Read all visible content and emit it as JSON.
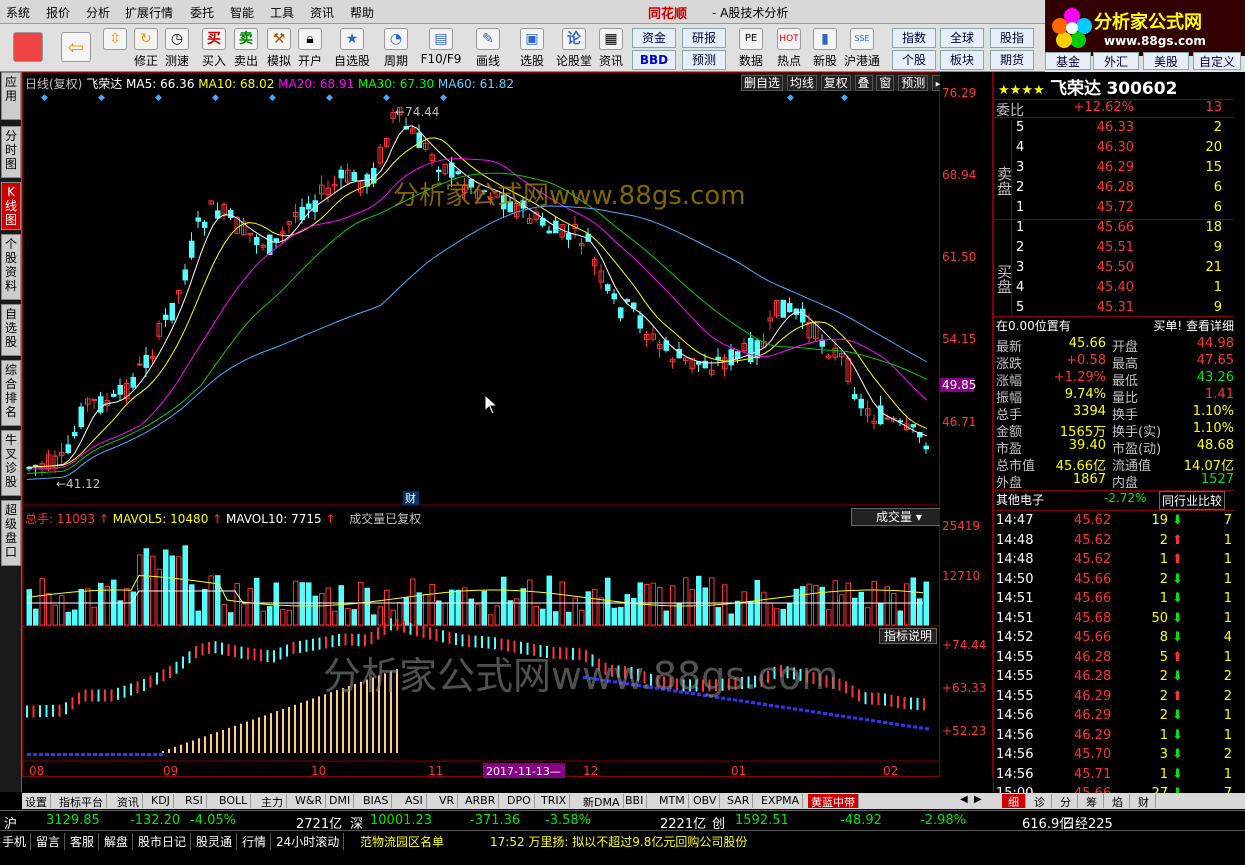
{
  "menu": [
    "系统",
    "报价",
    "分析",
    "扩展行情",
    "委托",
    "智能",
    "工具",
    "资讯",
    "帮助"
  ],
  "app_title": "同花顺",
  "app_sub": "- A股技术分析",
  "logo": {
    "text": "分析家公式网",
    "url": "www.88gs.com"
  },
  "toolbar": [
    "修正",
    "测速",
    "买入",
    "卖出",
    "模拟",
    "开户",
    "自选股",
    "周期",
    "F10/F9",
    "画线",
    "选股",
    "论股堂",
    "资讯",
    "数据",
    "热点",
    "新股",
    "沪港通"
  ],
  "toolbar_small": [
    {
      "label": "资金"
    },
    {
      "label": "研报"
    },
    {
      "label": "指数"
    },
    {
      "label": "全球"
    },
    {
      "label": "股指"
    },
    {
      "label": "BBD"
    },
    {
      "label": "预测"
    },
    {
      "label": "个股"
    },
    {
      "label": "板块"
    },
    {
      "label": "期货"
    },
    {
      "label": "基金"
    },
    {
      "label": "外汇"
    },
    {
      "label": "美股"
    },
    {
      "label": "自定义"
    }
  ],
  "left_nav": [
    {
      "label": "应用"
    },
    {
      "label": "分时图"
    },
    {
      "label": "K线图",
      "active": true
    },
    {
      "label": "个股资料"
    },
    {
      "label": "自选股"
    },
    {
      "label": "综合排名"
    },
    {
      "label": "牛叉诊股"
    },
    {
      "label": "超级盘口"
    }
  ],
  "chart_header": {
    "period": "日线(复权)",
    "name": "飞荣达",
    "ma5": "MA5: 66.36",
    "ma10": "MA10: 68.02",
    "ma20": "MA20: 68.91",
    "ma30": "MA30: 67.30",
    "ma60": "MA60: 61.82",
    "tools": [
      "删自选",
      "均线",
      "复权",
      "叠",
      "窗",
      "预测"
    ]
  },
  "vol_header": {
    "total": "总手: 11093",
    "mavol5": "MAVOL5: 10480",
    "mavol10": "MAVOL10: 7715",
    "note": "成交量已复权",
    "select": "成交量"
  },
  "indicator_btn": "指标说明",
  "price_axis": [
    "76.29",
    "68.94",
    "61.50",
    "54.15",
    "46.71"
  ],
  "price_current": "49.85",
  "high_label": "74.44",
  "low_label": "41.12",
  "cai_label": "财",
  "vol_axis": [
    "25419",
    "12710"
  ],
  "ind_axis": [
    "+74.44",
    "+63.33",
    "+52.23"
  ],
  "x_axis": [
    "08",
    "09",
    "10",
    "11",
    "12",
    "01",
    "02"
  ],
  "x_cursor": "2017-11-13",
  "watermark": "分析家公式网www.88gs.com",
  "stock": {
    "stars": "★★★★",
    "name": "飞荣达",
    "code": "300602"
  },
  "weibi": {
    "label": "委比",
    "value": "+12.62%",
    "count": "13"
  },
  "sell": [
    {
      "lvl": "5",
      "price": "46.33",
      "vol": "2"
    },
    {
      "lvl": "4",
      "price": "46.30",
      "vol": "20"
    },
    {
      "lvl": "3",
      "price": "46.29",
      "vol": "15"
    },
    {
      "lvl": "2",
      "price": "46.28",
      "vol": "6"
    },
    {
      "lvl": "1",
      "price": "45.72",
      "vol": "6"
    }
  ],
  "buy": [
    {
      "lvl": "1",
      "price": "45.66",
      "vol": "18"
    },
    {
      "lvl": "2",
      "price": "45.51",
      "vol": "9"
    },
    {
      "lvl": "3",
      "price": "45.50",
      "vol": "21"
    },
    {
      "lvl": "4",
      "price": "45.40",
      "vol": "1"
    },
    {
      "lvl": "5",
      "price": "45.31",
      "vol": "9"
    }
  ],
  "sell_label": "卖盘",
  "buy_label": "买盘",
  "position": {
    "left": "在0.00位置有",
    "right": "买单! 查看详细"
  },
  "quote": [
    {
      "l": "最新",
      "v": "45.66",
      "l2": "开盘",
      "v2": "44.98"
    },
    {
      "l": "涨跌",
      "v": "+0.58",
      "l2": "最高",
      "v2": "47.65"
    },
    {
      "l": "涨幅",
      "v": "+1.29%",
      "l2": "最低",
      "v2": "43.26"
    },
    {
      "l": "振幅",
      "v": "9.74%",
      "l2": "量比",
      "v2": "1.41"
    },
    {
      "l": "总手",
      "v": "3394",
      "l2": "换手",
      "v2": "1.10%"
    },
    {
      "l": "金额",
      "v": "1565万",
      "l2": "换手(实)",
      "v2": "1.10%"
    },
    {
      "l": "市盈",
      "v": "39.40",
      "l2": "市盈(动)",
      "v2": "48.68"
    },
    {
      "l": "总市值",
      "v": "45.66亿",
      "l2": "流通值",
      "v2": "14.07亿"
    },
    {
      "l": "外盘",
      "v": "1867",
      "l2": "内盘",
      "v2": "1527"
    }
  ],
  "sector": {
    "name": "其他电子",
    "chg": "-2.72%",
    "compare": "同行业比较"
  },
  "ticks": [
    {
      "t": "14:47",
      "p": "45.62",
      "v": "19",
      "d": "down",
      "n": "7"
    },
    {
      "t": "14:48",
      "p": "45.62",
      "v": "2",
      "d": "up",
      "n": "1"
    },
    {
      "t": "14:48",
      "p": "45.62",
      "v": "1",
      "d": "up",
      "n": "1"
    },
    {
      "t": "14:50",
      "p": "45.66",
      "v": "2",
      "d": "down",
      "n": "1"
    },
    {
      "t": "14:51",
      "p": "45.66",
      "v": "1",
      "d": "down",
      "n": "1"
    },
    {
      "t": "14:51",
      "p": "45.68",
      "v": "50",
      "d": "down",
      "n": "1"
    },
    {
      "t": "14:52",
      "p": "45.66",
      "v": "8",
      "d": "down",
      "n": "4"
    },
    {
      "t": "14:55",
      "p": "46.28",
      "v": "5",
      "d": "up",
      "n": "1"
    },
    {
      "t": "14:55",
      "p": "46.28",
      "v": "2",
      "d": "down",
      "n": "2"
    },
    {
      "t": "14:55",
      "p": "46.29",
      "v": "2",
      "d": "up",
      "n": "2"
    },
    {
      "t": "14:56",
      "p": "46.29",
      "v": "2",
      "d": "down",
      "n": "1"
    },
    {
      "t": "14:56",
      "p": "46.29",
      "v": "1",
      "d": "down",
      "n": "1"
    },
    {
      "t": "14:56",
      "p": "45.70",
      "v": "3",
      "d": "down",
      "n": "2"
    },
    {
      "t": "14:56",
      "p": "45.71",
      "v": "1",
      "d": "down",
      "n": "1"
    },
    {
      "t": "15:00",
      "p": "45.66",
      "v": "27",
      "d": "down",
      "n": "7"
    }
  ],
  "bottom_tabs": [
    "设置",
    "指标平台",
    "资讯",
    "KDJ",
    "RSI",
    "BOLL",
    "主力",
    "W&R",
    "DMI",
    "BIAS",
    "ASI",
    "VR",
    "ARBR",
    "DPO",
    "TRIX",
    "新DMA",
    "BBI",
    "MTM",
    "OBV",
    "SAR",
    "EXPMA",
    "黄蓝中带"
  ],
  "right_tabs": [
    "细",
    "诊",
    "分",
    "筹",
    "焰",
    "财"
  ],
  "status1": [
    {
      "t": "沪",
      "c": "white"
    },
    {
      "t": "3129.85",
      "c": "green"
    },
    {
      "t": "-132.20",
      "c": "green"
    },
    {
      "t": "-4.05%",
      "c": "green"
    },
    {
      "t": "2721亿",
      "c": "white"
    },
    {
      "t": "深",
      "c": "white"
    },
    {
      "t": "10001.23",
      "c": "green"
    },
    {
      "t": "-371.36",
      "c": "green"
    },
    {
      "t": "-3.58%",
      "c": "green"
    },
    {
      "t": "2221亿",
      "c": "white"
    },
    {
      "t": "创",
      "c": "white"
    },
    {
      "t": "1592.51",
      "c": "green"
    },
    {
      "t": "-48.92",
      "c": "green"
    },
    {
      "t": "-2.98%",
      "c": "green"
    },
    {
      "t": "616.9亿",
      "c": "white"
    },
    {
      "t": "日经225",
      "c": "white"
    }
  ],
  "status2": [
    "手机",
    "留言",
    "客服",
    "解盘",
    "股市日记",
    "股灵通",
    "行情",
    "24小时滚动"
  ],
  "news1": "范物流园区名单",
  "news2": "17:52 万里扬: 拟以不超过9.8亿元回购公司股份"
}
